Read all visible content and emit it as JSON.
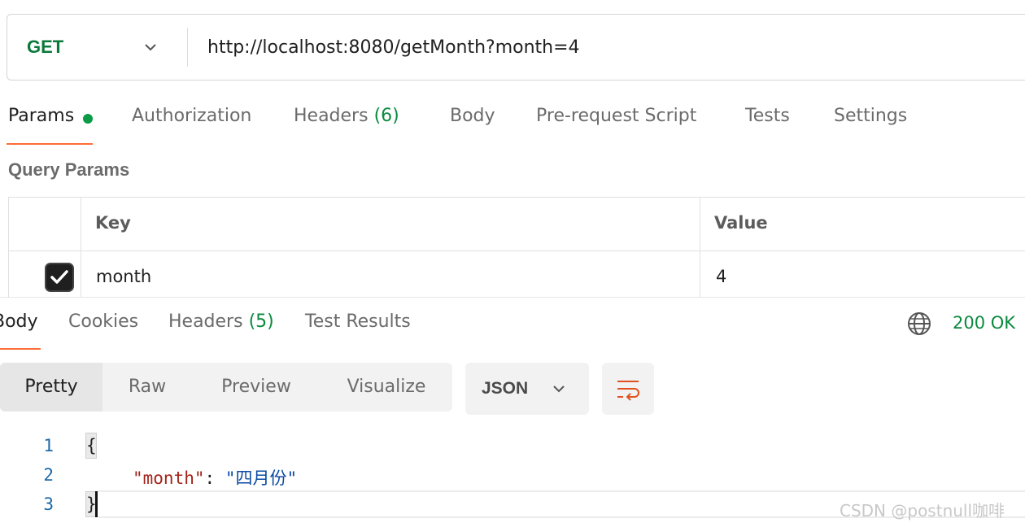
{
  "request": {
    "method": "GET",
    "url": "http://localhost:8080/getMonth?month=4"
  },
  "request_tabs": [
    {
      "label": "Params",
      "active": true,
      "has_dot": true
    },
    {
      "label": "Authorization"
    },
    {
      "label": "Headers",
      "count": "(6)"
    },
    {
      "label": "Body"
    },
    {
      "label": "Pre-request Script"
    },
    {
      "label": "Tests"
    },
    {
      "label": "Settings"
    }
  ],
  "query_params": {
    "title": "Query Params",
    "columns": [
      "Key",
      "Value"
    ],
    "rows": [
      {
        "checked": true,
        "key": "month",
        "value": "4"
      }
    ]
  },
  "response_tabs": [
    {
      "label": "Body",
      "active": true
    },
    {
      "label": "Cookies"
    },
    {
      "label": "Headers",
      "count": "(5)"
    },
    {
      "label": "Test Results"
    }
  ],
  "response_status": "200 OK",
  "view_modes": [
    "Pretty",
    "Raw",
    "Preview",
    "Visualize"
  ],
  "format_select": "JSON",
  "code": {
    "line_numbers": [
      "1",
      "2",
      "3"
    ],
    "open_brace": "{",
    "key": "\"month\"",
    "colon": ": ",
    "value": "\"四月份\"",
    "close_brace": "}"
  },
  "watermark": "CSDN @postnull咖啡",
  "colors": {
    "method_green": "#0a7a3a",
    "accent_orange": "#ff6c37",
    "status_green": "#0a8a3f"
  }
}
